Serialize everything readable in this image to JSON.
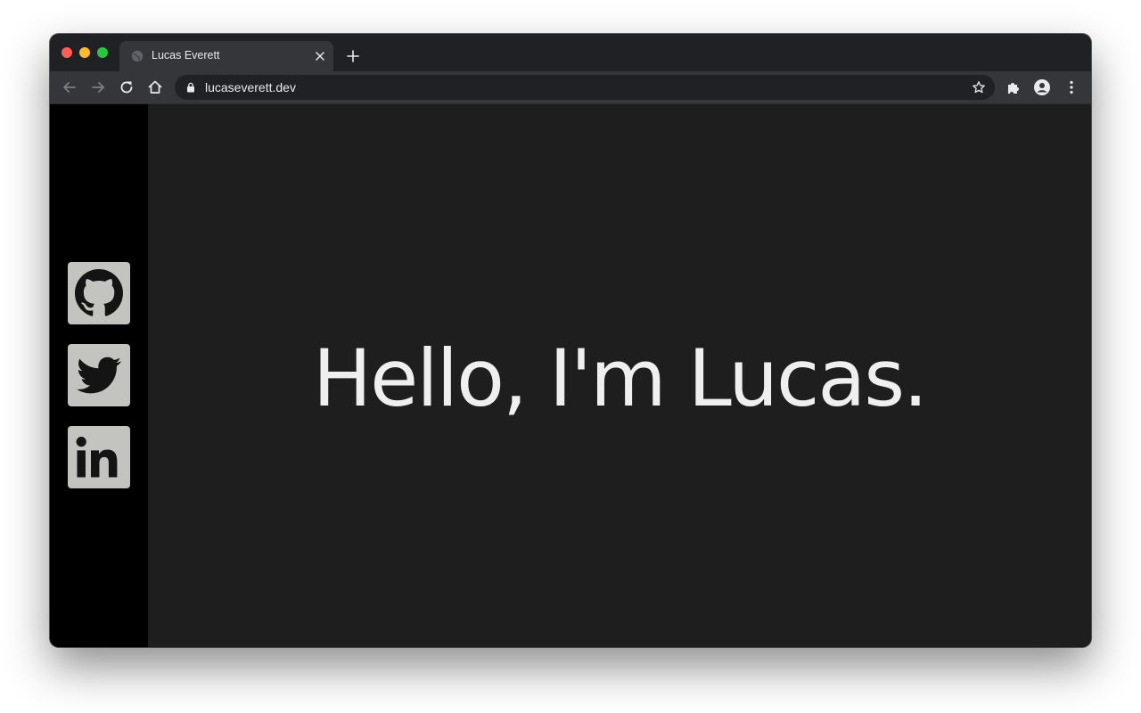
{
  "browser": {
    "tab": {
      "title": "Lucas Everett"
    },
    "address_bar": {
      "url": "lucaseverett.dev"
    }
  },
  "sidebar": {
    "social_links": [
      {
        "icon": "github-icon"
      },
      {
        "icon": "twitter-icon"
      },
      {
        "icon": "linkedin-icon"
      }
    ]
  },
  "hero": {
    "heading": "Hello, I'm Lucas."
  },
  "colors": {
    "page_background": "#1e1e1e",
    "sidebar_background": "#000000",
    "social_tile": "#c3c3bf",
    "heading_text": "#efefef"
  }
}
